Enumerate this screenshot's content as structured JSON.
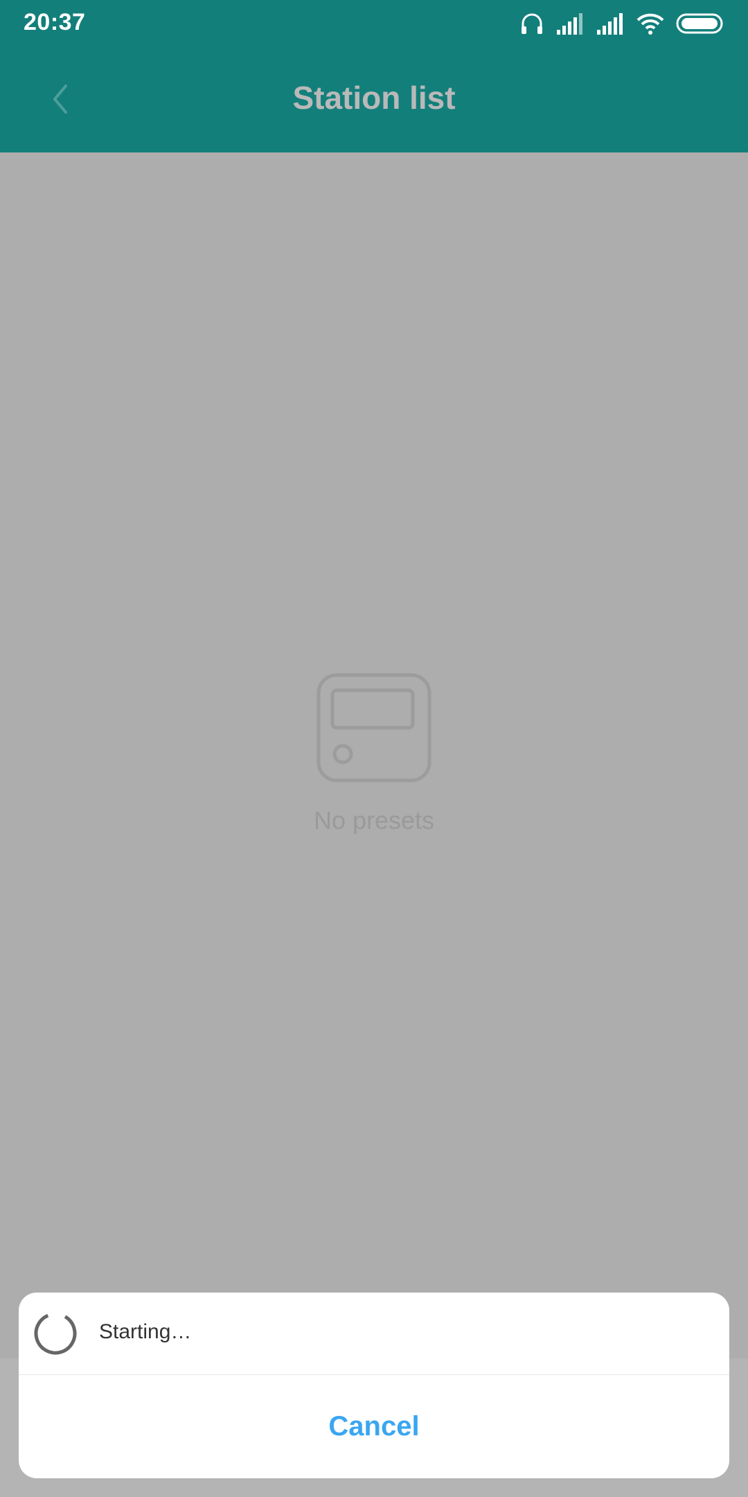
{
  "status_bar": {
    "time": "20:37",
    "icons": [
      "headphones-icon",
      "signal-1-icon",
      "signal-2-icon",
      "wifi-icon",
      "battery-icon"
    ]
  },
  "app_bar": {
    "title": "Station list",
    "back_icon": "chevron-left-icon"
  },
  "empty_state": {
    "icon": "radio-icon",
    "text": "No presets"
  },
  "dialog": {
    "message": "Starting…",
    "cancel_label": "Cancel",
    "spinner_icon": "loading-spinner-icon"
  },
  "colors": {
    "app_bar": "#137f7b",
    "overlay": "#adadad",
    "accent": "#3aa6f0"
  }
}
